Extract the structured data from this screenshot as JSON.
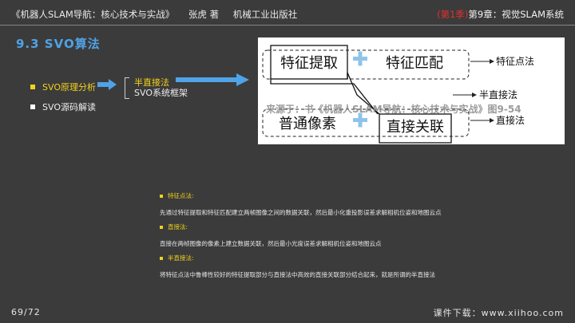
{
  "header": {
    "book": "《机器人SLAM导航：核心技术与实战》",
    "author": "张虎 著",
    "publisher": "机械工业出版社",
    "semester": "(第1季)",
    "chapter": "第9章：视觉SLAM系统"
  },
  "section_title": "9.3  SVO算法",
  "bullets": {
    "item1": "SVO原理分析",
    "item2": "SVO源码解读",
    "sub1": "半直接法",
    "sub2": "SVO系统框架"
  },
  "diagram": {
    "box_feature_extract": "特征提取",
    "box_feature_match": "特征匹配",
    "box_ordinary_pixel": "普通像素",
    "box_direct_assoc": "直接关联",
    "label_feature_method": "特征点法",
    "label_semi_direct": "半直接法",
    "label_direct_method": "直接法",
    "plus": "+",
    "watermark": "来源于：书《机器人SLAM导航：核心技术与实战》图9-54"
  },
  "body": {
    "h1": "特征点法:",
    "p1": "先通过特征提取和特征匹配建立两帧图像之间的数据关联，然后最小化重投影误差求解相机位姿和地图云点",
    "h2": "直接法:",
    "p2": "直接在两帧图像的像素上建立数据关联，然后最小光度误差求解相机位姿和地图云点",
    "h3": "半直接法:",
    "p3": "将特征点法中鲁棒性较好的特征提取部分与直接法中高效的直接关联部分结合起来，就是所谓的半直接法"
  },
  "footer": {
    "page": "69/72",
    "download": "课件下载：www.xiihoo.com"
  },
  "colors": {
    "accent_blue": "#4fa3e6",
    "highlight_yellow": "#f2d21b",
    "semester_red": "#e53030",
    "plus_blue": "#8fc4e8"
  }
}
